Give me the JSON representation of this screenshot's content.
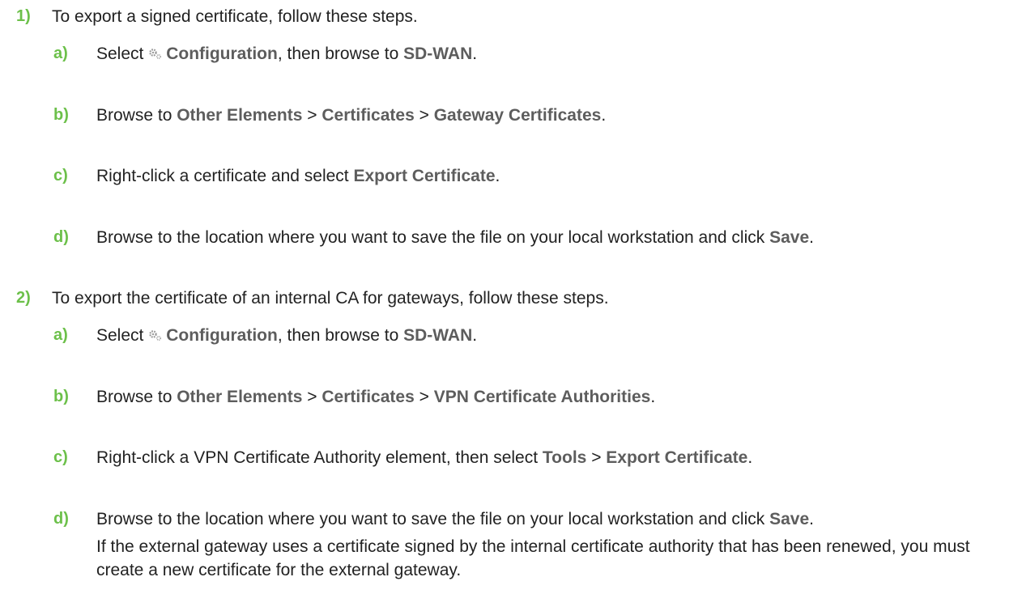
{
  "steps": [
    {
      "num": "1)",
      "text": "To export a signed certificate, follow these steps.",
      "subs": [
        {
          "letter": "a)",
          "parts": [
            "Select ",
            "Configuration",
            ", then browse to ",
            "SD-WAN",
            "."
          ]
        },
        {
          "letter": "b)",
          "parts": [
            "Browse to ",
            "Other Elements",
            " > ",
            "Certificates",
            " > ",
            "Gateway Certificates",
            "."
          ]
        },
        {
          "letter": "c)",
          "parts": [
            "Right-click a certificate and select ",
            "Export Certificate",
            "."
          ]
        },
        {
          "letter": "d)",
          "parts": [
            "Browse to the location where you want to save the file on your local workstation and click ",
            "Save",
            "."
          ]
        }
      ]
    },
    {
      "num": "2)",
      "text": "To export the certificate of an internal CA for gateways, follow these steps.",
      "subs": [
        {
          "letter": "a)",
          "parts": [
            "Select ",
            "Configuration",
            ", then browse to ",
            "SD-WAN",
            "."
          ]
        },
        {
          "letter": "b)",
          "parts": [
            "Browse to ",
            "Other Elements",
            " > ",
            "Certificates",
            " > ",
            "VPN Certificate Authorities",
            "."
          ]
        },
        {
          "letter": "c)",
          "parts": [
            "Right-click a VPN Certificate Authority element, then select ",
            "Tools",
            " > ",
            "Export Certificate",
            "."
          ]
        },
        {
          "letter": "d)",
          "parts": [
            "Browse to the location where you want to save the file on your local workstation and click ",
            "Save",
            "."
          ]
        }
      ],
      "note": "If the external gateway uses a certificate signed by the internal certificate authority that has been renewed, you must create a new certificate for the external gateway."
    }
  ],
  "icons": {
    "configuration": "gear-icon"
  },
  "colors": {
    "step_number": "#6cc04a",
    "ui_label": "#5d5d5d",
    "text": "#222222"
  }
}
